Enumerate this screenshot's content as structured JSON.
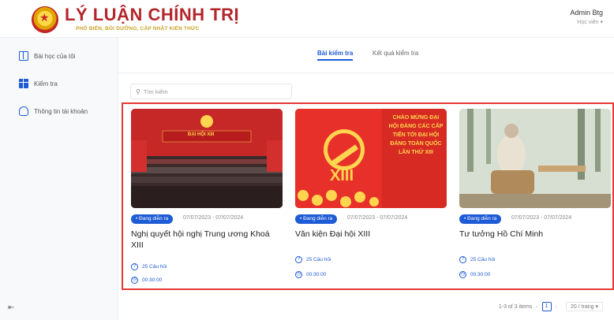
{
  "header": {
    "title": "LÝ LUẬN CHÍNH TRỊ",
    "subtitle": "PHỔ BIẾN, BỒI DƯỠNG, CẬP NHẬT KIẾN THỨC",
    "user_name": "Admin Btg",
    "user_role": "Học viên ▾"
  },
  "sidebar": {
    "items": [
      {
        "label": "Bài học của tôi",
        "icon": "book-icon"
      },
      {
        "label": "Kiểm tra",
        "icon": "exam-grid-icon"
      },
      {
        "label": "Thông tin tài khoản",
        "icon": "user-icon"
      }
    ],
    "collapse_label": "⇤"
  },
  "tabs": [
    {
      "label": "Bài kiểm tra",
      "active": true
    },
    {
      "label": "Kết quả kiểm tra",
      "active": false
    }
  ],
  "search": {
    "placeholder": "Tìm kiếm",
    "icon": "search-icon"
  },
  "cards": [
    {
      "badge": "• Đang diễn ra",
      "date": "07/07/2023 - 07/07/2024",
      "title": "Nghị quyết hội nghị Trung ương Khoá XIII",
      "questions": "25 Câu hỏi",
      "duration": "00:30:00",
      "image_text": "ĐẠI HỘI XIII"
    },
    {
      "badge": "• Đang diễn ra",
      "date": "07/07/2023 - 07/07/2024",
      "title": "Văn kiện Đại hội XIII",
      "questions": "25 Câu hỏi",
      "duration": "00:30:00",
      "image_text": "CHÀO MỪNG ĐẠI HỘI ĐẢNG CÁC CẤP TIẾN TỚI ĐẠI HỘI ĐẢNG TOÀN QUỐC LẦN THỨ XIII",
      "image_roman": "XIII"
    },
    {
      "badge": "• Đang diễn ra",
      "date": "07/07/2023 - 07/07/2024",
      "title": "Tư tưởng Hồ Chí Minh",
      "questions": "25 Câu hỏi",
      "duration": "00:30:00"
    }
  ],
  "pagination": {
    "summary": "1-3 of 3 items",
    "prev": "‹",
    "page": "1",
    "next": "›",
    "page_size": "20 / trang ▾"
  },
  "colors": {
    "primary": "#1e5bd6",
    "brand_red": "#b3262b",
    "highlight_border": "#e53935"
  }
}
